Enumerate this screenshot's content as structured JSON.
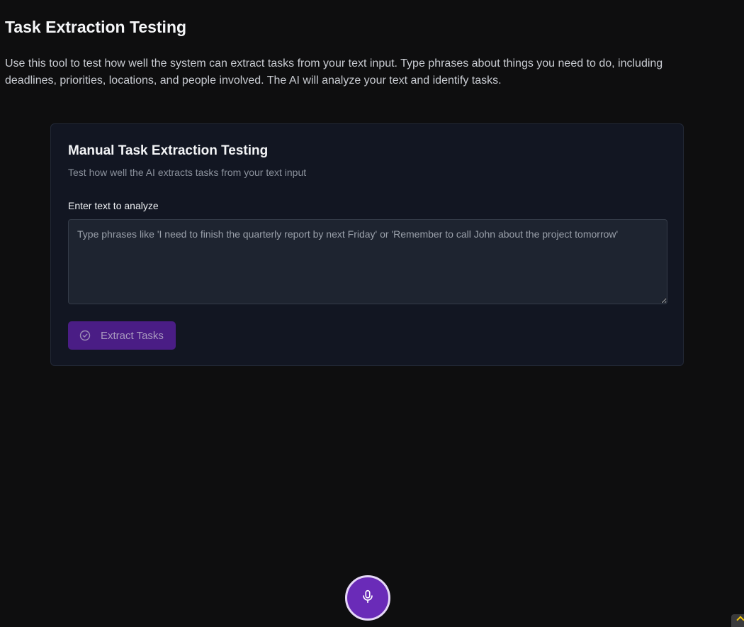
{
  "header": {
    "title": "Task Extraction Testing",
    "intro": "Use this tool to test how well the system can extract tasks from your text input. Type phrases about things you need to do, including deadlines, priorities, locations, and people involved. The AI will analyze your text and identify tasks."
  },
  "card": {
    "title": "Manual Task Extraction Testing",
    "subtitle": "Test how well the AI extracts tasks from your text input",
    "input_label": "Enter text to analyze",
    "input_value": "",
    "input_placeholder": "Type phrases like 'I need to finish the quarterly report by next Friday' or 'Remember to call John about the project tomorrow'",
    "button_label": "Extract Tasks",
    "button_icon": "check-circle-icon"
  },
  "mic": {
    "icon": "microphone-icon"
  },
  "colors": {
    "background": "#0e0e0f",
    "card": "#121622",
    "accent": "#6a2bb8",
    "button_disabled": "#4a1d85"
  }
}
